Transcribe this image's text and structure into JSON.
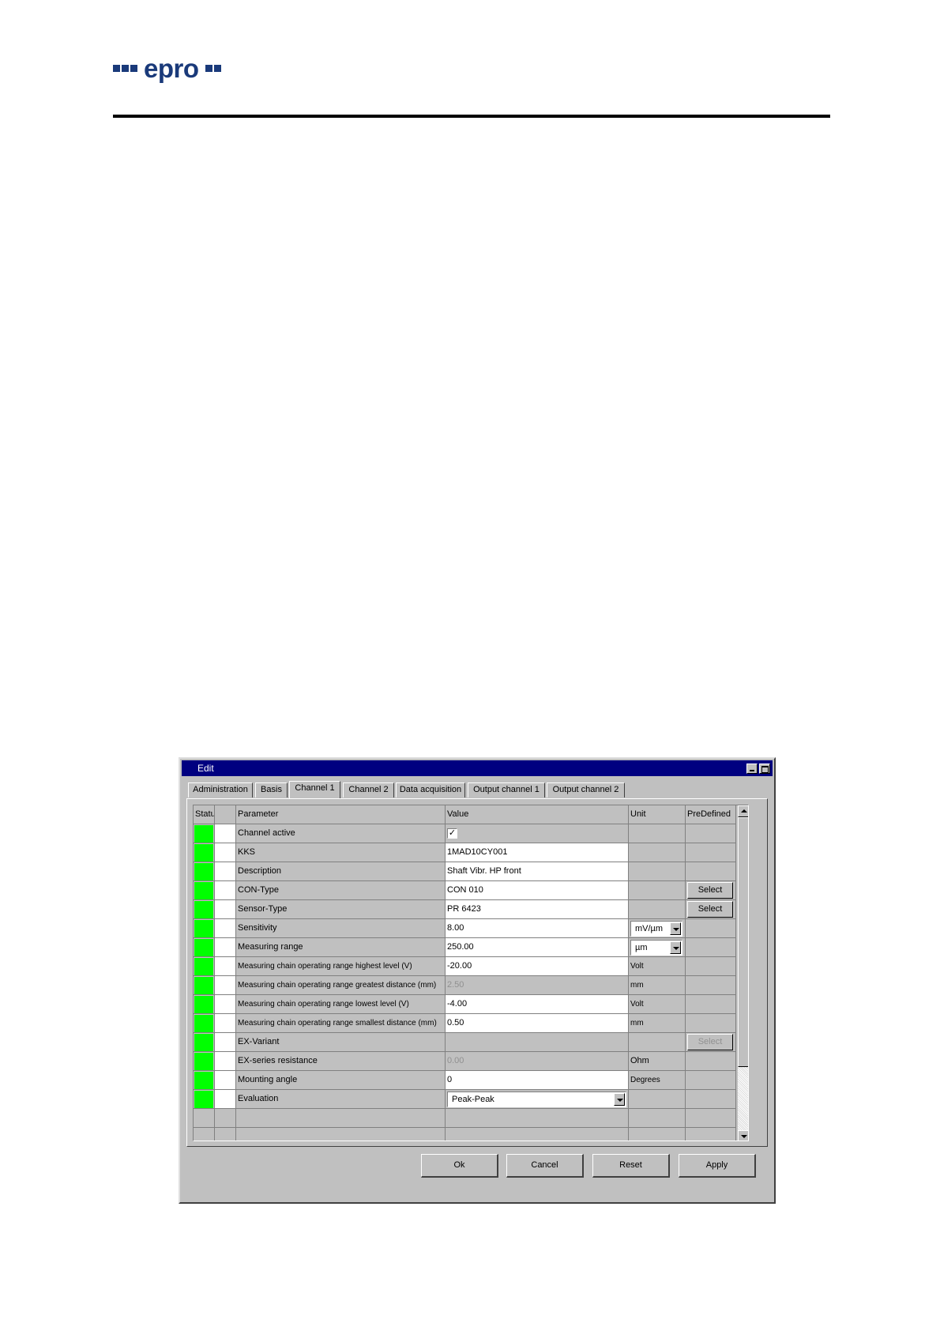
{
  "page": {
    "logo_text": "epro"
  },
  "dialog": {
    "title": "Edit",
    "tabs": [
      {
        "label": "Administration",
        "active": false
      },
      {
        "label": "Basis",
        "active": false
      },
      {
        "label": "Channel 1",
        "active": true
      },
      {
        "label": "Channel 2",
        "active": false
      },
      {
        "label": "Data acquisition",
        "active": false
      },
      {
        "label": "Output channel 1",
        "active": false
      },
      {
        "label": "Output channel 2",
        "active": false
      }
    ],
    "columns": {
      "status": "Status",
      "parameter": "Parameter",
      "value": "Value",
      "unit": "Unit",
      "predefined": "PreDefined"
    },
    "rows": [
      {
        "parameter": "Channel active",
        "value": "",
        "checked": true,
        "unit": "",
        "predefined": ""
      },
      {
        "parameter": "KKS",
        "value": "1MAD10CY001",
        "unit": "",
        "predefined": ""
      },
      {
        "parameter": "Description",
        "value": "Shaft Vibr. HP front",
        "unit": "",
        "predefined": ""
      },
      {
        "parameter": "CON-Type",
        "value": "CON 010",
        "unit": "",
        "predefined": "Select"
      },
      {
        "parameter": "Sensor-Type",
        "value": "PR 6423",
        "unit": "",
        "predefined": "Select"
      },
      {
        "parameter": "Sensitivity",
        "value": "8.00",
        "unit": "mV/µm",
        "predefined": ""
      },
      {
        "parameter": "Measuring range",
        "value": "250.00",
        "unit": "µm",
        "predefined": ""
      },
      {
        "parameter": "Measuring chain operating range highest level (V)",
        "value": "-20.00",
        "unit": "Volt",
        "predefined": ""
      },
      {
        "parameter": "Measuring chain operating range greatest distance (mm)",
        "value": "2.50",
        "unit": "mm",
        "predefined": ""
      },
      {
        "parameter": "Measuring chain operating range lowest level (V)",
        "value": "-4.00",
        "unit": "Volt",
        "predefined": ""
      },
      {
        "parameter": "Measuring chain operating range smallest distance (mm)",
        "value": "0.50",
        "unit": "mm",
        "predefined": ""
      },
      {
        "parameter": "EX-Variant",
        "value": "",
        "unit": "",
        "predefined": "Select"
      },
      {
        "parameter": "EX-series resistance",
        "value": "0.00",
        "unit": "Ohm",
        "predefined": ""
      },
      {
        "parameter": "Mounting angle",
        "value": "0",
        "unit": "Degrees",
        "predefined": ""
      },
      {
        "parameter": "Evaluation",
        "value": "Peak-Peak",
        "unit": "",
        "predefined": ""
      }
    ],
    "buttons": {
      "ok": "Ok",
      "cancel": "Cancel",
      "reset": "Reset",
      "apply": "Apply"
    },
    "colors": {
      "status_ok": "#00ff00",
      "titlebar": "#000080",
      "face": "#c0c0c0",
      "brand": "#1a3a7a"
    },
    "icons": [
      "check-icon",
      "chevron-down-icon",
      "scroll-up-icon",
      "scroll-down-icon",
      "minimize-icon",
      "maximize-icon"
    ]
  }
}
